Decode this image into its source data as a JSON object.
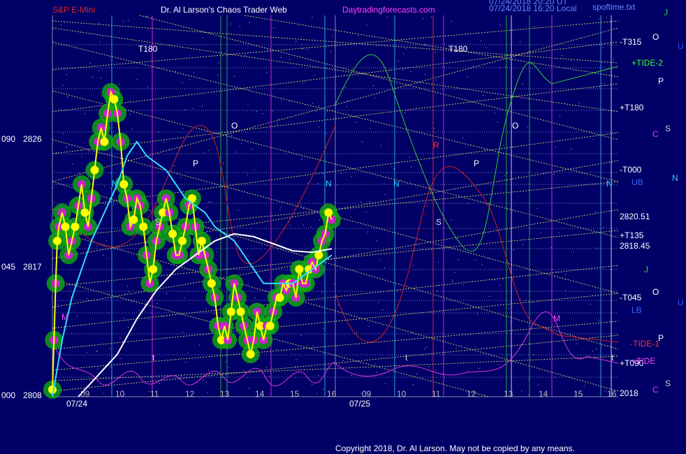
{
  "header": {
    "symbol": "S&P E-Mini",
    "site": "Dr. Al Larson's Chaos Trader Web",
    "url": "Daytradingforecasts.com",
    "timestamp1": "07/24/2018 20:20 UT",
    "timestamp2": "07/24/2018 16:20 Local",
    "filename": "spoftime.txt"
  },
  "footer": {
    "copyright": "Copyright 2018, Dr. Al Larson. May not be copied by any means."
  },
  "colors": {
    "background": "#000066",
    "grid": "#6f7fc8",
    "price": "#ffff00",
    "cyan_ma": "#33ddff",
    "white_ma": "#ffffff",
    "tide": "#33cc33",
    "red_line": "#cc2222",
    "magenta": "#dd33dd",
    "planet_lines": "#e8e870"
  },
  "chart_data": {
    "type": "line",
    "title": "S&P E-Mini",
    "dates": [
      "07/24",
      "07/25"
    ],
    "x_hour_labels": [
      "09",
      "10",
      "11",
      "12",
      "13",
      "14",
      "15",
      "16",
      "09",
      "10",
      "11",
      "12",
      "13",
      "14",
      "15",
      "16"
    ],
    "left_axis": [
      {
        "angle": "090",
        "price": "2826"
      },
      {
        "angle": "045",
        "price": "2817"
      },
      {
        "angle": "000",
        "price": "2808"
      }
    ],
    "ylim": [
      2808,
      2830
    ],
    "right_labels": [
      {
        "text": "-T315",
        "color": "#ffffff"
      },
      {
        "text": "+TIDE-2",
        "color": "#33ff33"
      },
      {
        "text": "+T180",
        "color": "#ffffff"
      },
      {
        "text": "-T000",
        "color": "#ffffff"
      },
      {
        "text": "2820.51",
        "color": "#ffffff"
      },
      {
        "text": "+T135",
        "color": "#ffffff"
      },
      {
        "text": "2818.45",
        "color": "#ffffff"
      },
      {
        "text": "-T045",
        "color": "#ffffff"
      },
      {
        "text": "-TIDE-1",
        "color": "#ff3333"
      },
      {
        "text": "+T090",
        "color": "#ffffff"
      },
      {
        "text": "+TIDE",
        "color": "#ff44ff"
      },
      {
        "text": "2018",
        "color": "#ffffff"
      }
    ],
    "band_labels": [
      "UB",
      "LB"
    ],
    "planet_letters_right": [
      {
        "text": "J",
        "color": "#33cc33"
      },
      {
        "text": "O",
        "color": "#ffffff"
      },
      {
        "text": "U",
        "color": "#3355ff"
      },
      {
        "text": "P",
        "color": "#ffffff"
      },
      {
        "text": "C",
        "color": "#ff33ff"
      },
      {
        "text": "S",
        "color": "#cccccc"
      },
      {
        "text": "N",
        "color": "#33ccff"
      },
      {
        "text": "J",
        "color": "#33cc33"
      },
      {
        "text": "O",
        "color": "#ffffff"
      },
      {
        "text": "U",
        "color": "#3355ff"
      },
      {
        "text": "P",
        "color": "#ffffff"
      },
      {
        "text": "C",
        "color": "#ff33ff"
      },
      {
        "text": "S",
        "color": "#cccccc"
      }
    ],
    "in_chart_labels": [
      {
        "text": "T180",
        "color": "#ffffff"
      },
      {
        "text": "T180",
        "color": "#ffffff"
      },
      {
        "text": "O",
        "color": "#ffffff"
      },
      {
        "text": "O",
        "color": "#ffffff"
      },
      {
        "text": "P",
        "color": "#ffffff"
      },
      {
        "text": "P",
        "color": "#ffffff"
      },
      {
        "text": "S",
        "color": "#dddddd"
      },
      {
        "text": "S",
        "color": "#dddddd"
      },
      {
        "text": "N",
        "color": "#33ccff"
      },
      {
        "text": "N",
        "color": "#33ccff"
      },
      {
        "text": "N",
        "color": "#33ccff"
      },
      {
        "text": "N",
        "color": "#33ccff"
      },
      {
        "text": "M",
        "color": "#ff44ff"
      },
      {
        "text": "M",
        "color": "#ff44ff"
      },
      {
        "text": "R",
        "color": "#ff3333"
      },
      {
        "text": "t",
        "color": "#dddddd"
      },
      {
        "text": "t",
        "color": "#dddddd"
      },
      {
        "text": "t",
        "color": "#dddddd"
      }
    ],
    "series": [
      {
        "kind": "price",
        "color": "#ffff00",
        "points": [
          [
            0,
            2808.5
          ],
          [
            0.5,
            2812
          ],
          [
            1,
            2816
          ],
          [
            1.5,
            2819
          ],
          [
            2,
            2820
          ],
          [
            3,
            2821
          ],
          [
            4,
            2820
          ],
          [
            5,
            2818
          ],
          [
            6,
            2819
          ],
          [
            7,
            2820
          ],
          [
            8,
            2821.5
          ],
          [
            9,
            2823
          ],
          [
            10,
            2821
          ],
          [
            11,
            2820
          ],
          [
            12,
            2822
          ],
          [
            13,
            2824
          ],
          [
            14,
            2826
          ],
          [
            15,
            2827
          ],
          [
            16,
            2826
          ],
          [
            17,
            2828
          ],
          [
            18,
            2829.5
          ],
          [
            19,
            2829
          ],
          [
            20,
            2828
          ],
          [
            21,
            2826
          ],
          [
            22,
            2823
          ],
          [
            23,
            2822
          ],
          [
            24,
            2820
          ],
          [
            25,
            2820.5
          ],
          [
            26,
            2822
          ],
          [
            27,
            2821.5
          ],
          [
            28,
            2820
          ],
          [
            29,
            2818
          ],
          [
            30,
            2816
          ],
          [
            31,
            2817
          ],
          [
            32,
            2819
          ],
          [
            33,
            2820
          ],
          [
            34,
            2821
          ],
          [
            35,
            2822
          ],
          [
            36,
            2821
          ],
          [
            37,
            2819.5
          ],
          [
            38,
            2818
          ],
          [
            39,
            2818
          ],
          [
            40,
            2819
          ],
          [
            41,
            2820
          ],
          [
            42,
            2821.5
          ],
          [
            43,
            2822
          ],
          [
            44,
            2820
          ],
          [
            45,
            2818
          ],
          [
            46,
            2819
          ],
          [
            47,
            2818
          ],
          [
            48,
            2817
          ],
          [
            49,
            2816
          ],
          [
            50,
            2815
          ],
          [
            51,
            2813
          ],
          [
            52,
            2812
          ],
          [
            53,
            2813
          ],
          [
            54,
            2812
          ],
          [
            55,
            2814
          ],
          [
            56,
            2816
          ],
          [
            57,
            2815
          ],
          [
            58,
            2814
          ],
          [
            59,
            2813
          ],
          [
            60,
            2812
          ],
          [
            61,
            2811
          ],
          [
            62,
            2812
          ],
          [
            63,
            2814
          ],
          [
            64,
            2813
          ],
          [
            65,
            2812
          ],
          [
            66,
            2813
          ],
          [
            67,
            2813
          ],
          [
            68,
            2814
          ],
          [
            69,
            2815
          ],
          [
            70,
            2815
          ],
          [
            71,
            2816
          ],
          [
            72,
            2815.5
          ],
          [
            73,
            2816
          ],
          [
            74,
            2816
          ],
          [
            75,
            2815
          ],
          [
            76,
            2817
          ],
          [
            77,
            2816
          ],
          [
            78,
            2816
          ],
          [
            79,
            2817
          ],
          [
            80,
            2817.5
          ],
          [
            81,
            2817
          ],
          [
            82,
            2818
          ],
          [
            83,
            2819
          ],
          [
            84,
            2819.5
          ],
          [
            85,
            2821
          ],
          [
            86,
            2820.5
          ]
        ]
      },
      {
        "kind": "cyan_ma",
        "color": "#33ddff",
        "points": [
          [
            0,
            2808
          ],
          [
            3,
            2812
          ],
          [
            6,
            2815
          ],
          [
            9,
            2817
          ],
          [
            12,
            2819
          ],
          [
            16,
            2821
          ],
          [
            20,
            2823
          ],
          [
            23,
            2825
          ],
          [
            26,
            2826
          ],
          [
            29,
            2825
          ],
          [
            32,
            2824.5
          ],
          [
            35,
            2824
          ],
          [
            38,
            2823
          ],
          [
            41,
            2822
          ],
          [
            44,
            2821.5
          ],
          [
            47,
            2821
          ],
          [
            50,
            2820
          ],
          [
            53,
            2819.5
          ],
          [
            56,
            2819
          ],
          [
            59,
            2818
          ],
          [
            62,
            2817
          ],
          [
            65,
            2816
          ],
          [
            68,
            2816
          ],
          [
            71,
            2816
          ],
          [
            74,
            2816
          ],
          [
            77,
            2816.5
          ],
          [
            80,
            2817
          ],
          [
            83,
            2817.5
          ],
          [
            86,
            2818
          ]
        ]
      },
      {
        "kind": "white_ma",
        "color": "#ffffff",
        "points": [
          [
            8,
            2808
          ],
          [
            14,
            2809.5
          ],
          [
            20,
            2811
          ],
          [
            26,
            2813.5
          ],
          [
            32,
            2815.5
          ],
          [
            38,
            2817
          ],
          [
            44,
            2818
          ],
          [
            50,
            2819
          ],
          [
            56,
            2819.5
          ],
          [
            62,
            2819.3
          ],
          [
            68,
            2818.8
          ],
          [
            74,
            2818.3
          ],
          [
            80,
            2818.2
          ],
          [
            86,
            2818.45
          ]
        ]
      }
    ]
  }
}
